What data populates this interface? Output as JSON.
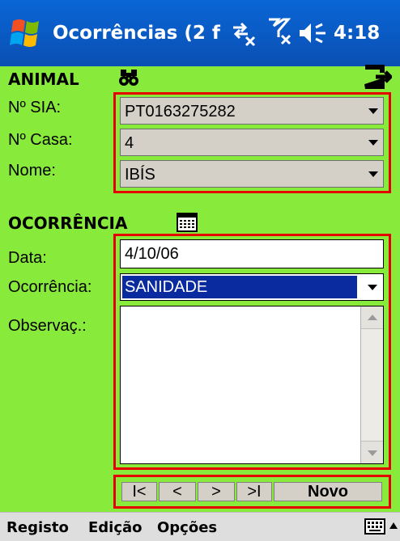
{
  "titlebar": {
    "title": "Ocorrências (2 f",
    "clock": "4:18"
  },
  "animal": {
    "section_title": "ANIMAL",
    "sia_label": "Nº SIA:",
    "sia_value": "PT0163275282",
    "casa_label": "Nº Casa:",
    "casa_value": "4",
    "nome_label": "Nome:",
    "nome_value": "IBÍS"
  },
  "ocorrencia": {
    "section_title": "OCORRÊNCIA",
    "data_label": "Data:",
    "data_value": "4/10/06",
    "ocorrencia_label": "Ocorrência:",
    "ocorrencia_value": "SANIDADE",
    "observacao_label": "Observaç.:",
    "observacao_value": ""
  },
  "nav": {
    "first": "I<",
    "prev": "<",
    "next": ">",
    "last": ">I",
    "new": "Novo"
  },
  "menubar": {
    "items": [
      "Registo",
      "Edição",
      "Opções"
    ]
  },
  "colors": {
    "background": "#88ea3a",
    "highlight_box": "#e40000",
    "selection": "#0a2aa0",
    "titlebar": "#0a5ac8"
  },
  "icons": [
    "windows-flag-icon",
    "sync-icon",
    "signal-icon",
    "volume-icon",
    "binoculars-icon",
    "exit-icon",
    "calendar-icon",
    "keyboard-icon"
  ]
}
